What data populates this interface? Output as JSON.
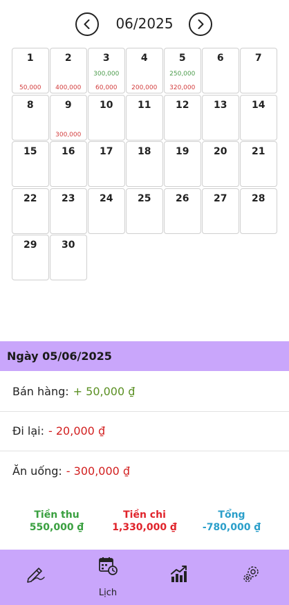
{
  "header": {
    "month_label": "06/2025"
  },
  "calendar": {
    "days": [
      {
        "day": "1",
        "income": "",
        "expense": "50,000"
      },
      {
        "day": "2",
        "income": "",
        "expense": "400,000"
      },
      {
        "day": "3",
        "income": "300,000",
        "expense": "60,000"
      },
      {
        "day": "4",
        "income": "",
        "expense": "200,000"
      },
      {
        "day": "5",
        "income": "250,000",
        "expense": "320,000"
      },
      {
        "day": "6",
        "income": "",
        "expense": ""
      },
      {
        "day": "7",
        "income": "",
        "expense": ""
      },
      {
        "day": "8",
        "income": "",
        "expense": ""
      },
      {
        "day": "9",
        "income": "",
        "expense": "300,000"
      },
      {
        "day": "10",
        "income": "",
        "expense": ""
      },
      {
        "day": "11",
        "income": "",
        "expense": ""
      },
      {
        "day": "12",
        "income": "",
        "expense": ""
      },
      {
        "day": "13",
        "income": "",
        "expense": ""
      },
      {
        "day": "14",
        "income": "",
        "expense": ""
      },
      {
        "day": "15",
        "income": "",
        "expense": ""
      },
      {
        "day": "16",
        "income": "",
        "expense": ""
      },
      {
        "day": "17",
        "income": "",
        "expense": ""
      },
      {
        "day": "18",
        "income": "",
        "expense": ""
      },
      {
        "day": "19",
        "income": "",
        "expense": ""
      },
      {
        "day": "20",
        "income": "",
        "expense": ""
      },
      {
        "day": "21",
        "income": "",
        "expense": ""
      },
      {
        "day": "22",
        "income": "",
        "expense": ""
      },
      {
        "day": "23",
        "income": "",
        "expense": ""
      },
      {
        "day": "24",
        "income": "",
        "expense": ""
      },
      {
        "day": "25",
        "income": "",
        "expense": ""
      },
      {
        "day": "26",
        "income": "",
        "expense": ""
      },
      {
        "day": "27",
        "income": "",
        "expense": ""
      },
      {
        "day": "28",
        "income": "",
        "expense": ""
      },
      {
        "day": "29",
        "income": "",
        "expense": ""
      },
      {
        "day": "30",
        "income": "",
        "expense": ""
      }
    ]
  },
  "detail": {
    "date_title": "Ngày 05/06/2025",
    "transactions": [
      {
        "label": "Bán hàng:",
        "amount": "+ 50,000 ₫",
        "kind": "income"
      },
      {
        "label": "Đi lại:",
        "amount": "- 20,000 ₫",
        "kind": "expense"
      },
      {
        "label": "Ăn uống:",
        "amount": "- 300,000 ₫",
        "kind": "expense"
      }
    ]
  },
  "summary": {
    "income_title": "Tiền thu",
    "income_value": "550,000 ₫",
    "expense_title": "Tiền chi",
    "expense_value": "1,330,000 ₫",
    "total_title": "Tổng",
    "total_value": "-780,000 ₫"
  },
  "bottom_nav": {
    "items": [
      {
        "icon": "write-hand-icon",
        "label": ""
      },
      {
        "icon": "calendar-clock-icon",
        "label": "Lịch"
      },
      {
        "icon": "chart-trend-icon",
        "label": ""
      },
      {
        "icon": "gear-icon",
        "label": ""
      }
    ]
  },
  "colors": {
    "accent": "#c9a6fb",
    "income": "#3aa040",
    "expense": "#e0242b",
    "total": "#2b9fca"
  }
}
